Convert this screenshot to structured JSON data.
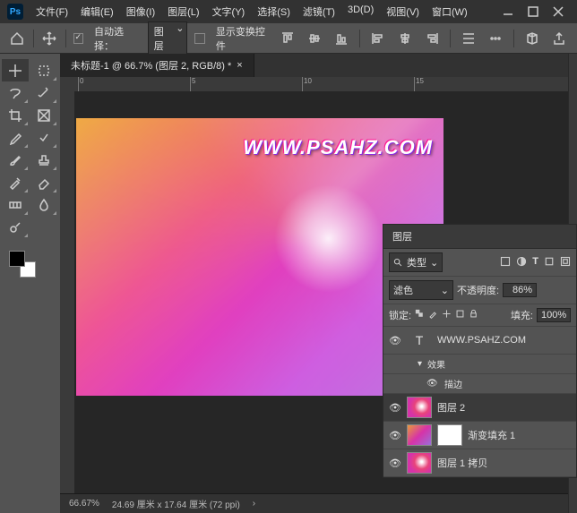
{
  "app": {
    "logo": "Ps"
  },
  "menu": [
    "文件(F)",
    "编辑(E)",
    "图像(I)",
    "图层(L)",
    "文字(Y)",
    "选择(S)",
    "滤镜(T)",
    "3D(D)",
    "视图(V)",
    "窗口(W)"
  ],
  "options": {
    "auto_select_label": "自动选择：",
    "auto_select_target": "图层",
    "show_transform_label": "显示变换控件"
  },
  "doc_tab": {
    "title": "未标题-1 @ 66.7% (图层 2, RGB/8) *"
  },
  "ruler_ticks": [
    "0",
    "5",
    "10",
    "15"
  ],
  "watermark": "WWW.PSAHZ.COM",
  "status": {
    "zoom": "66.67%",
    "dims": "24.69 厘米 x 17.64 厘米 (72 ppi)"
  },
  "layers_panel": {
    "tab": "图层",
    "kind_search": "类型",
    "blend_mode": "滤色",
    "opacity_label": "不透明度:",
    "opacity_value": "86%",
    "lock_label": "锁定:",
    "fill_label": "填充:",
    "fill_value": "100%",
    "items": [
      {
        "type": "text",
        "name": "WWW.PSAHZ.COM",
        "visible": true
      },
      {
        "type": "fx",
        "name": "效果"
      },
      {
        "type": "fx-sub",
        "name": "描边"
      },
      {
        "type": "raster",
        "name": "图层 2",
        "visible": true,
        "active": true
      },
      {
        "type": "adjustment",
        "name": "渐变填充 1",
        "visible": true
      },
      {
        "type": "smart",
        "name": "图层 1 拷贝",
        "visible": true
      }
    ]
  }
}
